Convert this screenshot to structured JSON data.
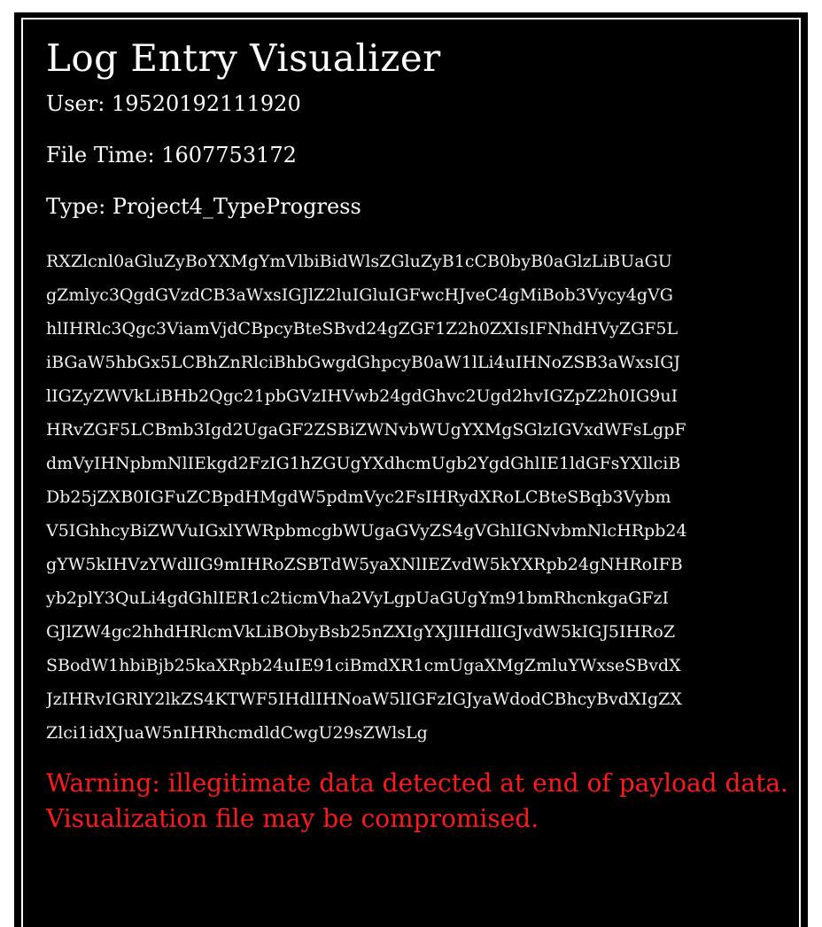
{
  "app": {
    "title": "Log Entry Visualizer"
  },
  "log": {
    "user": "User: 19520192111920",
    "file_time": "File Time: 1607753172",
    "type": "Type: Project4_TypeProgress"
  },
  "payload": {
    "lines": [
      "RXZlcnl0aGluZyBoYXMgYmVlbiBidWlsZGluZyB1cCB0byB0aGlzLiBUaGU",
      "gZmlyc3QgdGVzdCB3aWxsIGJlZ2luIGluIGFwcHJveC4gMiBob3Vycy4gVG",
      "hlIHRlc3Qgc3ViamVjdCBpcyBteSBvd24gZGF1Z2h0ZXIsIFNhdHVyZGF5L",
      "iBGaW5hbGx5LCBhZnRlciBhbGwgdGhpcyB0aW1lLi4uIHNoZSB3aWxsIGJ",
      "lIGZyZWVkLiBHb2Qgc21pbGVzIHVwb24gdGhvc2Ugd2hvIGZpZ2h0IG9uI",
      "HRvZGF5LCBmb3Igd2UgaGF2ZSBiZWNvbWUgYXMgSGlzIGVxdWFsLgpF",
      "dmVyIHNpbmNlIEkgd2FzIG1hZGUgYXdhcmUgb2YgdGhlIE1ldGFsYXllciB",
      "Db25jZXB0IGFuZCBpdHMgdW5pdmVyc2FsIHRydXRoLCBteSBqb3Vybm",
      "V5IGhhcyBiZWVuIGxlYWRpbmcgbWUgaGVyZS4gVGhlIGNvbmNlcHRpb24",
      "gYW5kIHVzYWdlIG9mIHRoZSBTdW5yaXNlIEZvdW5kYXRpb24gNHRoIFB",
      "yb2plY3QuLi4gdGhlIER1c2ticmVha2VyLgpUaGUgYm91bmRhcnkgaGFzI",
      "GJlZW4gc2hhdHRlcmVkLiBObyBsb25nZXIgYXJlIHdlIGJvdW5kIGJ5IHRoZ",
      "SBodW1hbiBjb25kaXRpb24uIE91ciBmdXR1cmUgaXMgZmluYWxseSBvdX",
      "JzIHRvIGRlY2lkZS4KTWF5IHdlIHNoaW5lIGFzIGJyaWdodCBhcyBvdXIgZX",
      "Zlci1idXJuaW5nIHRhcmdldCwgU29sZWlsLg"
    ]
  },
  "warning": {
    "text": "Warning: illegitimate data detected at end of payload data. Visualization file may be compromised."
  },
  "colors": {
    "background": "#000000",
    "text": "#ffffff",
    "highlight": "#ffe07a",
    "warning": "#ff1a1a"
  }
}
